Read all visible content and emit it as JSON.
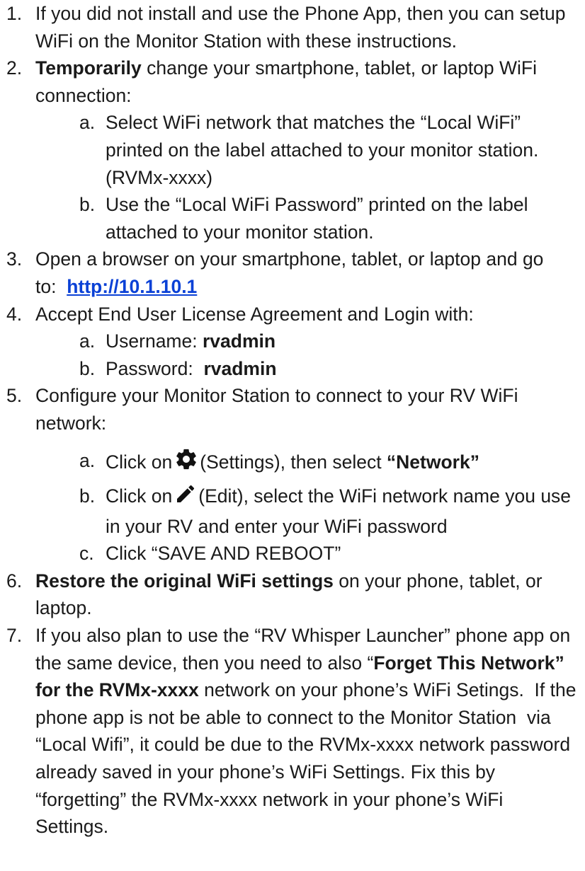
{
  "steps": [
    {
      "num": "1.",
      "text": "If you did not install and use the Phone App, then you can setup WiFi on the Monitor Station with these instructions."
    },
    {
      "num": "2.",
      "bold": "Temporarily",
      "text": " change your smartphone, tablet, or laptop WiFi connection:"
    },
    {
      "num": "3.",
      "text": "Open a browser on your smartphone, tablet, or laptop and go to:",
      "link": "http://10.1.10.1"
    },
    {
      "num": "4.",
      "text": "Accept End User License Agreement and Login with:"
    },
    {
      "num": "5.",
      "text": "Configure your Monitor Station to connect to your RV WiFi network:"
    },
    {
      "num": "6.",
      "bold": "Restore the original WiFi settings",
      "text": " on your phone, tablet, or laptop."
    },
    {
      "num": "7.",
      "text1": "If you also plan to use the “RV Whisper Launcher” phone app on the same device, then you need to also “",
      "bold1": "Forget This Network” for the RVMx-xxxx",
      "text2": " network on your phone’s WiFi Setings.  If the phone app is not be able to connect to the Monitor Station  via “Local Wifi”, it could be due to the RVMx-xxxx network password already saved in your phone’s WiFi Settings. Fix this by “forgetting” the RVMx-xxxx network in your phone’s WiFi Settings."
    }
  ],
  "sub2": [
    {
      "num": "a.",
      "text": "Select WiFi network that matches the “Local WiFi” printed on the label attached to your monitor station. (RVMx-xxxx)"
    },
    {
      "num": "b.",
      "text": "Use the “Local WiFi Password” printed on the label attached to your monitor station."
    }
  ],
  "sub4": [
    {
      "num": "a.",
      "label": "Username: ",
      "value": "rvadmin"
    },
    {
      "num": "b.",
      "label": "Password:  ",
      "value": "rvadmin"
    }
  ],
  "sub5": [
    {
      "num": "a.",
      "pre": "Click on",
      "post": "(Settings), then select ",
      "bold": "“Network”",
      "icon": "gear-icon"
    },
    {
      "num": "b.",
      "pre": "Click on",
      "post": "(Edit), select the WiFi network name you use in your RV and enter your WiFi password",
      "icon": "pencil-icon"
    },
    {
      "num": "c.",
      "text": "Click “SAVE AND REBOOT”"
    }
  ],
  "colors": {
    "link": "#0b41d6",
    "text": "#1a1a1a"
  }
}
